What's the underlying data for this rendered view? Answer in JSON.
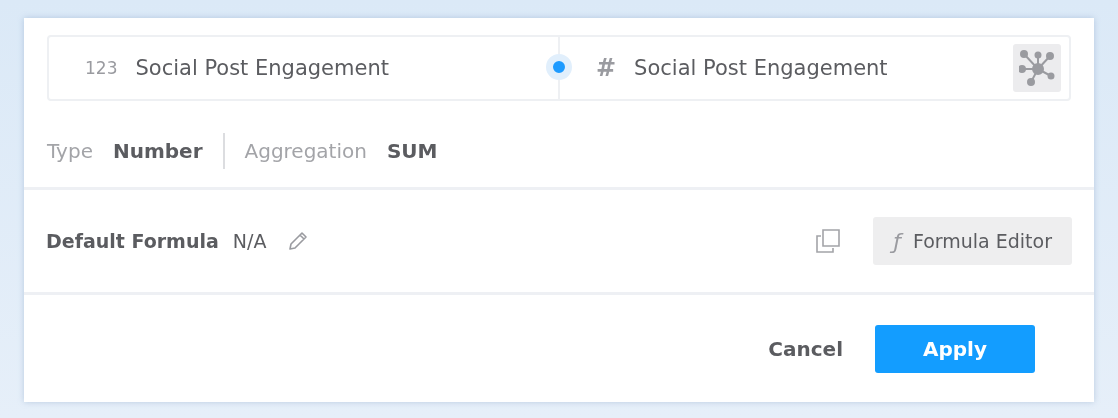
{
  "mapping": {
    "source": {
      "type_glyph": "123",
      "name": "Social Post Engagement"
    },
    "target": {
      "type_glyph": "#",
      "name": "Social Post Engagement"
    }
  },
  "properties": [
    {
      "label": "Type",
      "value": "Number"
    },
    {
      "label": "Aggregation",
      "value": "SUM"
    }
  ],
  "formula": {
    "label": "Default Formula",
    "value": "N/A",
    "editor_glyph": "ƒ",
    "editor_label": "Formula Editor"
  },
  "buttons": [
    {
      "label": "Cancel",
      "kind": "secondary"
    },
    {
      "label": "Apply",
      "kind": "primary"
    }
  ]
}
